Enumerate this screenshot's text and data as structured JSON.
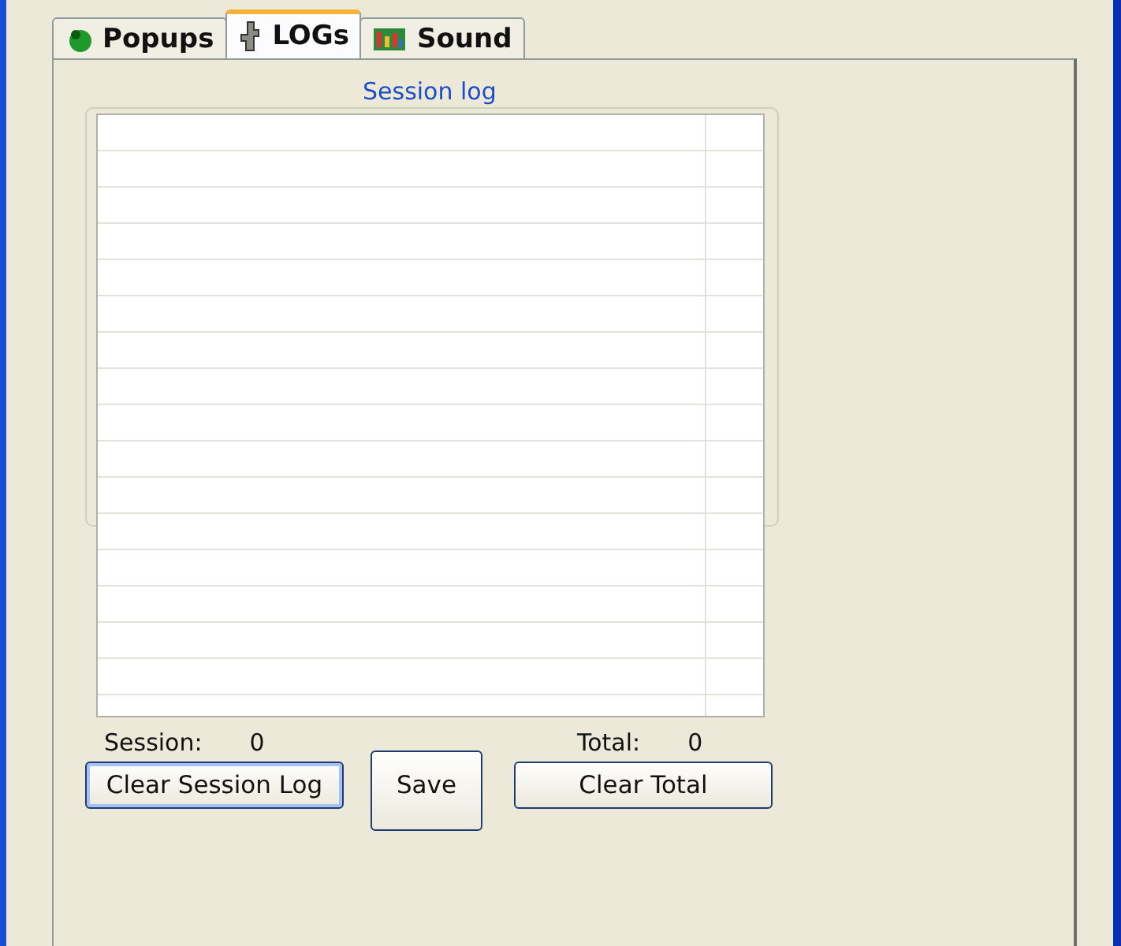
{
  "tabs": [
    {
      "label": "Popups",
      "selected": false
    },
    {
      "label": "LOGs",
      "selected": true
    },
    {
      "label": "Sound",
      "selected": false
    }
  ],
  "session_log": {
    "title": "Session log"
  },
  "session": {
    "label": "Session:",
    "value": "0"
  },
  "total": {
    "label": "Total:",
    "value": "0"
  },
  "buttons": [
    {
      "label": "Clear Session Log",
      "focused": true
    },
    {
      "label": "Save",
      "focused": false
    },
    {
      "label": "Clear Total",
      "focused": false
    }
  ]
}
